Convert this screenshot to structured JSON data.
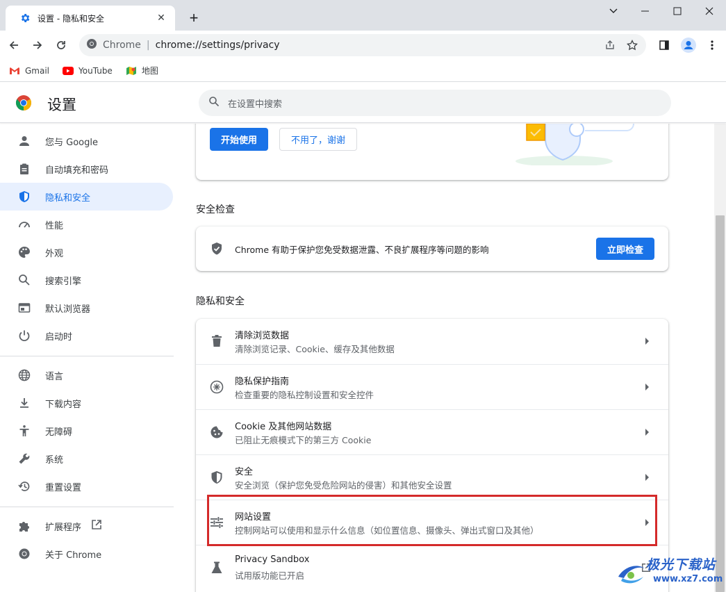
{
  "tab": {
    "title": "设置 - 隐私和安全",
    "close": "✕"
  },
  "window": {
    "minimize": "—",
    "maximize": "☐",
    "close": "✕",
    "dropdown": "⌄"
  },
  "omnibox": {
    "site": "Chrome",
    "separator": "|",
    "url": "chrome://settings/privacy"
  },
  "bookmarks": [
    {
      "label": "Gmail",
      "icon": "gmail-icon"
    },
    {
      "label": "YouTube",
      "icon": "youtube-icon"
    },
    {
      "label": "地图",
      "icon": "maps-icon"
    }
  ],
  "header": {
    "title": "设置",
    "search_placeholder": "在设置中搜索"
  },
  "sidebar": {
    "items": [
      {
        "label": "您与 Google",
        "icon": "person-icon"
      },
      {
        "label": "自动填充和密码",
        "icon": "clipboard-icon"
      },
      {
        "label": "隐私和安全",
        "icon": "shield-icon",
        "active": true
      },
      {
        "label": "性能",
        "icon": "speedometer-icon"
      },
      {
        "label": "外观",
        "icon": "palette-icon"
      },
      {
        "label": "搜索引擎",
        "icon": "search-icon"
      },
      {
        "label": "默认浏览器",
        "icon": "browser-icon"
      },
      {
        "label": "启动时",
        "icon": "power-icon"
      },
      {
        "label": "语言",
        "icon": "globe-icon"
      },
      {
        "label": "下载内容",
        "icon": "download-icon"
      },
      {
        "label": "无障碍",
        "icon": "accessibility-icon"
      },
      {
        "label": "系统",
        "icon": "wrench-icon"
      },
      {
        "label": "重置设置",
        "icon": "history-icon"
      },
      {
        "label": "扩展程序",
        "icon": "puzzle-icon"
      },
      {
        "label": "关于 Chrome",
        "icon": "chrome-icon"
      }
    ]
  },
  "promo": {
    "start_label": "开始使用",
    "dismiss_label": "不用了，谢谢"
  },
  "safety_check": {
    "section_title": "安全检查",
    "description": "Chrome 有助于保护您免受数据泄露、不良扩展程序等问题的影响",
    "button_label": "立即检查"
  },
  "privacy": {
    "section_title": "隐私和安全",
    "rows": [
      {
        "title": "清除浏览数据",
        "subtitle": "清除浏览记录、Cookie、缓存及其他数据",
        "icon": "trash-icon"
      },
      {
        "title": "隐私保护指南",
        "subtitle": "检查重要的隐私控制设置和安全控件",
        "icon": "compass-icon"
      },
      {
        "title": "Cookie 及其他网站数据",
        "subtitle": "已阻止无痕模式下的第三方 Cookie",
        "icon": "cookie-icon"
      },
      {
        "title": "安全",
        "subtitle": "安全浏览（保护您免受危险网站的侵害）和其他安全设置",
        "icon": "shield-icon"
      },
      {
        "title": "网站设置",
        "subtitle": "控制网站可以使用和显示什么信息（如位置信息、摄像头、弹出式窗口及其他）",
        "icon": "tune-icon"
      },
      {
        "title": "Privacy Sandbox",
        "subtitle": "试用版功能已开启",
        "icon": "flask-icon"
      }
    ]
  },
  "watermark": {
    "title": "极光下载站",
    "url": "www.xz7.com"
  },
  "colors": {
    "accent": "#1a73e8",
    "highlight": "#d42a2a",
    "tabstrip": "#dee1e6"
  }
}
